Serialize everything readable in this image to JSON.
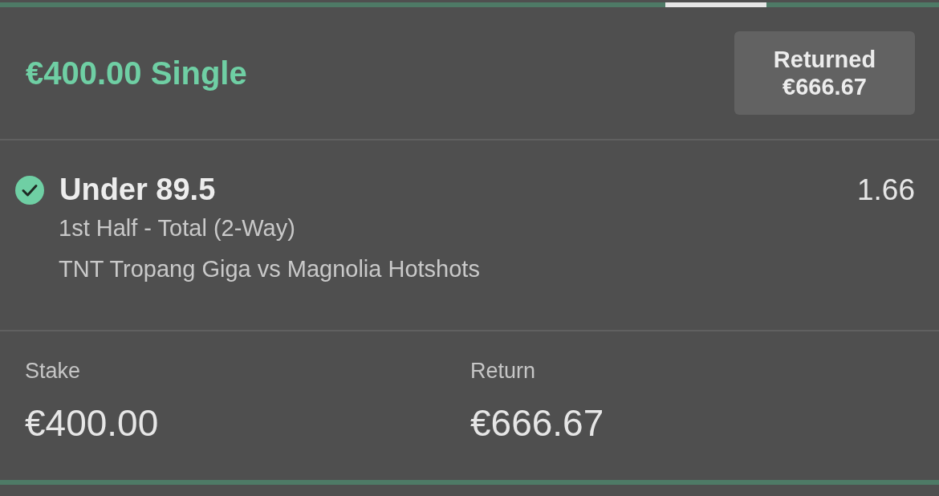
{
  "bet": {
    "title": "€400.00 Single",
    "settled": {
      "label": "Returned",
      "amount": "€666.67"
    }
  },
  "selections": [
    {
      "won": true,
      "name": "Under 89.5",
      "odds": "1.66",
      "market": "1st Half - Total (2-Way)",
      "event": "TNT Tropang Giga vs Magnolia Hotshots"
    }
  ],
  "summary": [
    {
      "label": "Stake",
      "value": "€400.00"
    },
    {
      "label": "Return",
      "value": "€666.67"
    }
  ]
}
